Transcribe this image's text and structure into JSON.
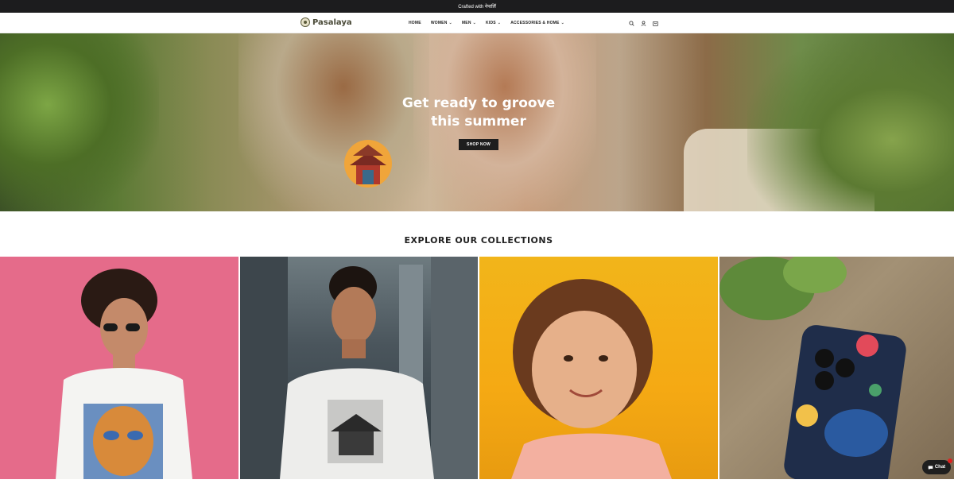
{
  "announcement": {
    "text": "Crafted with नेपालिँ"
  },
  "header": {
    "brand": "Pasalaya",
    "nav": [
      {
        "label": "HOME",
        "dropdown": false
      },
      {
        "label": "WOMEN",
        "dropdown": true
      },
      {
        "label": "MEN",
        "dropdown": true
      },
      {
        "label": "KIDS",
        "dropdown": true
      },
      {
        "label": "ACCESSORIES & HOME",
        "dropdown": true
      }
    ],
    "icons": [
      "search-icon",
      "account-icon",
      "cart-icon"
    ]
  },
  "hero": {
    "title_line1": "Get ready to groove",
    "title_line2": "this summer",
    "cta": "SHOP NOW"
  },
  "collections": {
    "title": "EXPLORE OUR COLLECTIONS"
  },
  "chat": {
    "label": "Chat"
  }
}
